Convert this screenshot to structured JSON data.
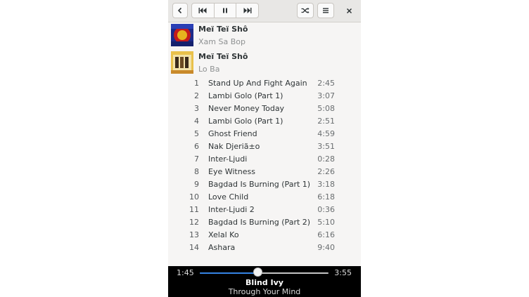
{
  "header": {
    "buttons": [
      {
        "name": "back-button",
        "icon": "chevron-left-icon"
      },
      {
        "name": "previous-button",
        "icon": "skip-backward-icon"
      },
      {
        "name": "pause-button",
        "icon": "pause-icon"
      },
      {
        "name": "next-button",
        "icon": "skip-forward-icon"
      },
      {
        "name": "shuffle-button",
        "icon": "shuffle-icon"
      },
      {
        "name": "menu-button",
        "icon": "hamburger-menu-icon"
      },
      {
        "name": "close-button",
        "icon": "close-icon"
      }
    ]
  },
  "albums": [
    {
      "artist": "Meï Teï Shô",
      "title": "Xam Sa Bop"
    },
    {
      "artist": "Meï Teï Shô",
      "title": "Lo Ba"
    }
  ],
  "tracks": [
    {
      "num": "1",
      "title": "Stand Up And Fight Again",
      "duration": "2:45"
    },
    {
      "num": "2",
      "title": "Lambi Golo (Part 1)",
      "duration": "3:07"
    },
    {
      "num": "3",
      "title": "Never Money Today",
      "duration": "5:08"
    },
    {
      "num": "4",
      "title": "Lambi Golo (Part 1)",
      "duration": "2:51"
    },
    {
      "num": "5",
      "title": "Ghost Friend",
      "duration": "4:59"
    },
    {
      "num": "6",
      "title": "Nak Djeriã±o",
      "duration": "3:51"
    },
    {
      "num": "7",
      "title": "Inter-Ljudi",
      "duration": "0:28"
    },
    {
      "num": "8",
      "title": "Eye Witness",
      "duration": "2:26"
    },
    {
      "num": "9",
      "title": "Bagdad Is Burning (Part 1)",
      "duration": "3:18"
    },
    {
      "num": "10",
      "title": "Love Child",
      "duration": "6:18"
    },
    {
      "num": "11",
      "title": "Inter-Ljudi 2",
      "duration": "0:36"
    },
    {
      "num": "12",
      "title": "Bagdad Is Burning (Part 2)",
      "duration": "5:10"
    },
    {
      "num": "13",
      "title": "Xelal Ko",
      "duration": "6:16"
    },
    {
      "num": "14",
      "title": "Ashara",
      "duration": "9:40"
    }
  ],
  "player": {
    "elapsed": "1:45",
    "total": "3:55",
    "progress": 0.45,
    "track_title": "Blind Ivy",
    "album_title": "Through Your Mind",
    "accent_color": "#3584e4"
  }
}
